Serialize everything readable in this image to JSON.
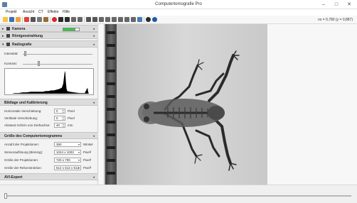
{
  "window": {
    "title": "Computertomografie Pro",
    "minimize": "–",
    "maximize": "□",
    "close": "✕"
  },
  "menu": [
    "Projekt",
    "Ansicht",
    "CT",
    "Effekte",
    "Hilfe"
  ],
  "toolbar": {
    "coords": "nx = 0,780  (y = 0,887)",
    "buttons": [
      {
        "name": "new-project-icon",
        "color": "#f4c542"
      },
      {
        "name": "save-icon",
        "color": "#3f6fb5"
      },
      {
        "name": "open-folder-icon",
        "color": "#e8a33a"
      },
      {
        "name": "camera-icon",
        "color": "#d9453a"
      },
      {
        "name": "image-icon",
        "color": "#555555"
      },
      {
        "name": "copy-icon",
        "color": "#777777"
      },
      {
        "name": "export-icon",
        "color": "#9a6b3b"
      },
      {
        "name": "record-icon",
        "color": "#d42b2b"
      },
      {
        "name": "play-icon",
        "color": "#2b2b2b"
      },
      {
        "name": "pause-icon",
        "color": "#2b2b2b"
      },
      {
        "name": "grid-icon",
        "color": "#666666"
      },
      {
        "name": "rotate-icon",
        "color": "#666666"
      },
      {
        "name": "crosshair-icon",
        "color": "#555555"
      },
      {
        "name": "zoom-fit-icon",
        "color": "#555555"
      },
      {
        "name": "measure-icon",
        "color": "#666666"
      },
      {
        "name": "frame-icon",
        "color": "#666666"
      },
      {
        "name": "volume-icon",
        "color": "#666666"
      },
      {
        "name": "filter-icon",
        "color": "#666666"
      },
      {
        "name": "slice-icon",
        "color": "#666666"
      },
      {
        "name": "stack-icon",
        "color": "#666666"
      },
      {
        "name": "reconstruct-icon",
        "color": "#4a7ab8"
      },
      {
        "name": "help-icon",
        "color": "#2b2b2b"
      },
      {
        "name": "about-icon",
        "color": "#1f5aa8"
      }
    ]
  },
  "sidebar": {
    "sections": {
      "kamera": {
        "label": "Kamera",
        "pin": "◂"
      },
      "roentgen": {
        "label": "Röntgenstrahlung",
        "pin": "◂"
      },
      "radiografie": {
        "label": "Radiografie",
        "pin": "◂",
        "intensity_label": "Intensität:",
        "contrast_label": "Kontrast:",
        "intensity_level": 0.03,
        "contrast_level": 0.22
      },
      "bildlage": {
        "label": "Bildlage und Kalibrierung",
        "pin": "◂",
        "fields": [
          {
            "label": "Horizontale Verschiebung:",
            "value": "0",
            "unit": "Pixel"
          },
          {
            "label": "Vertikale Verschiebung:",
            "value": "0",
            "unit": "Pixel"
          },
          {
            "label": "Abstand Schirm von Drehachse:",
            "value": "40",
            "unit": "mm"
          }
        ]
      },
      "groesse": {
        "label": "Größe des Computertomogramms",
        "pin": "◂",
        "fields": [
          {
            "label": "Anzahl der Projektionen:",
            "value": "360",
            "unit": "Winkel"
          },
          {
            "label": "Sensorauflösung (Binning):",
            "value": "1024 x 1003",
            "unit": "Pixel²"
          },
          {
            "label": "Größe der Projektionen:",
            "value": "720 x 700",
            "unit": "Pixel²"
          },
          {
            "label": "Größe der Rekonstruktion:",
            "value": "512 x 512 x 512",
            "unit": "Pixel³"
          }
        ]
      },
      "avi": {
        "label": "AVI-Export",
        "pin": "◂"
      }
    }
  },
  "timeline": {
    "position": 0.0
  }
}
